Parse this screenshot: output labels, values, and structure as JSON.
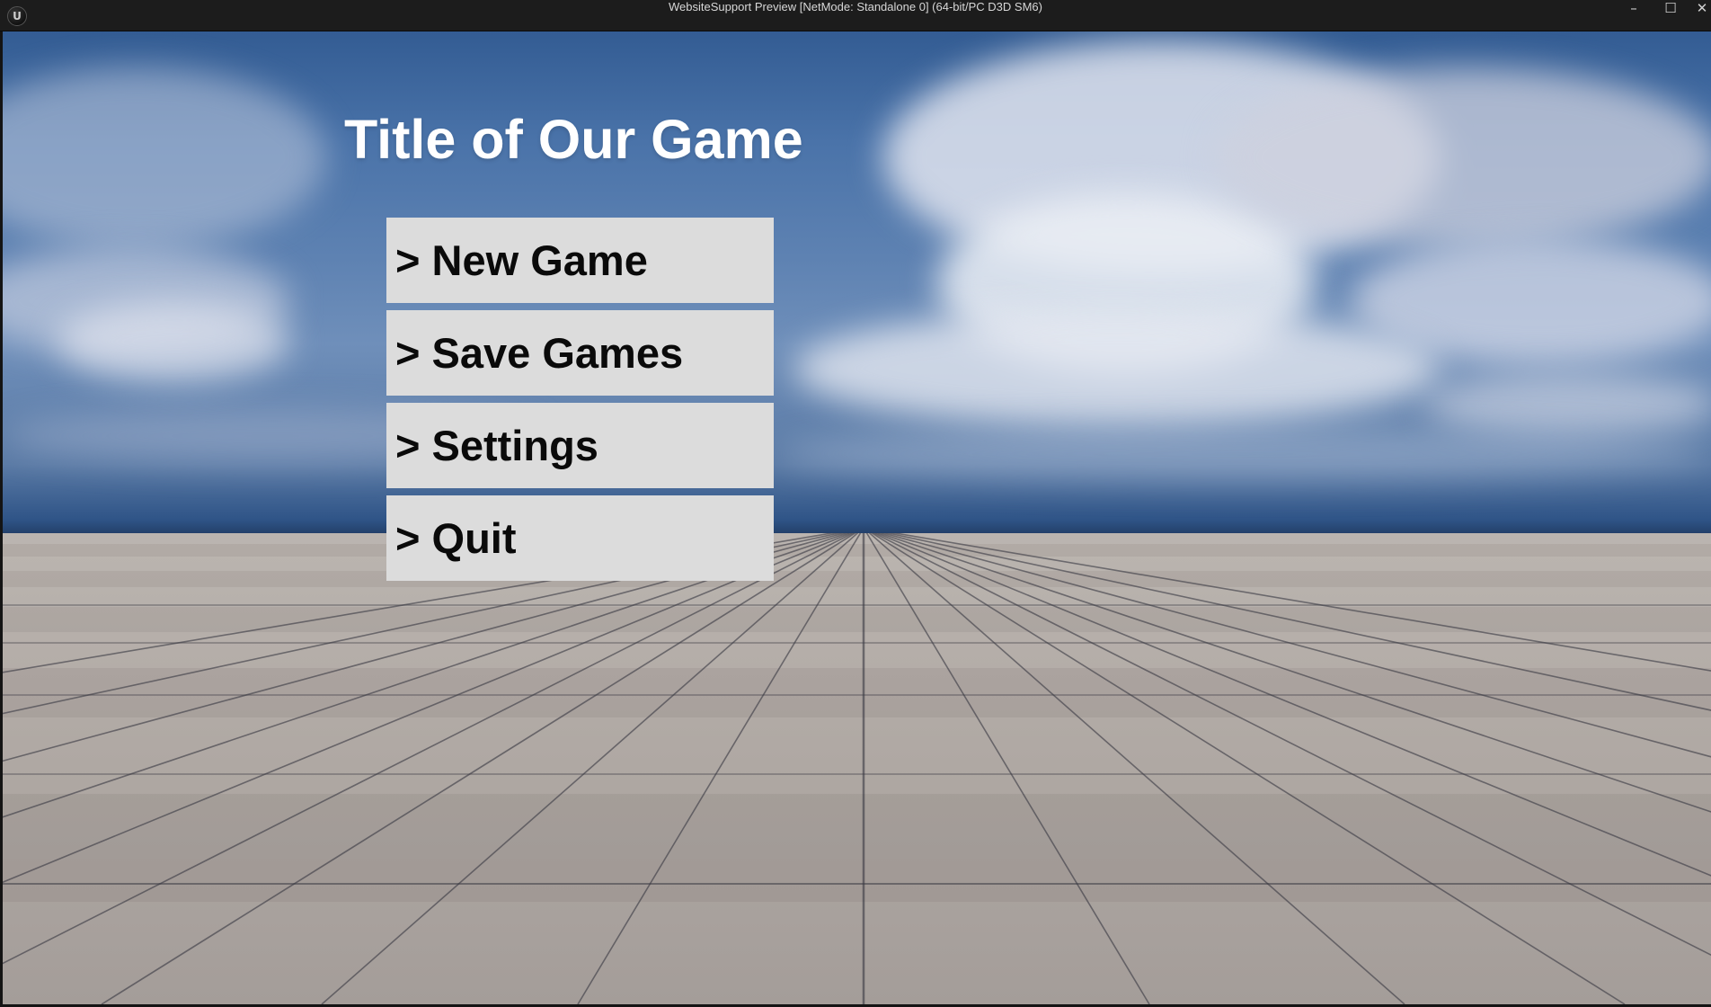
{
  "window": {
    "title": "WebsiteSupport Preview [NetMode: Standalone 0]  (64-bit/PC D3D SM6)",
    "minimize_glyph": "–",
    "maximize_glyph": "☐",
    "close_glyph": "✕",
    "logo_icon": "unreal-engine-icon"
  },
  "game": {
    "title": "Title of Our Game"
  },
  "menu": {
    "items": [
      {
        "label": "> New Game"
      },
      {
        "label": "> Save Games"
      },
      {
        "label": "> Settings"
      },
      {
        "label": "> Quit"
      }
    ]
  },
  "colors": {
    "button_bg": "#dcdcdc",
    "button_text": "#0a0a0a",
    "title_text": "#ffffff",
    "titlebar_bg": "#1c1c1c"
  }
}
